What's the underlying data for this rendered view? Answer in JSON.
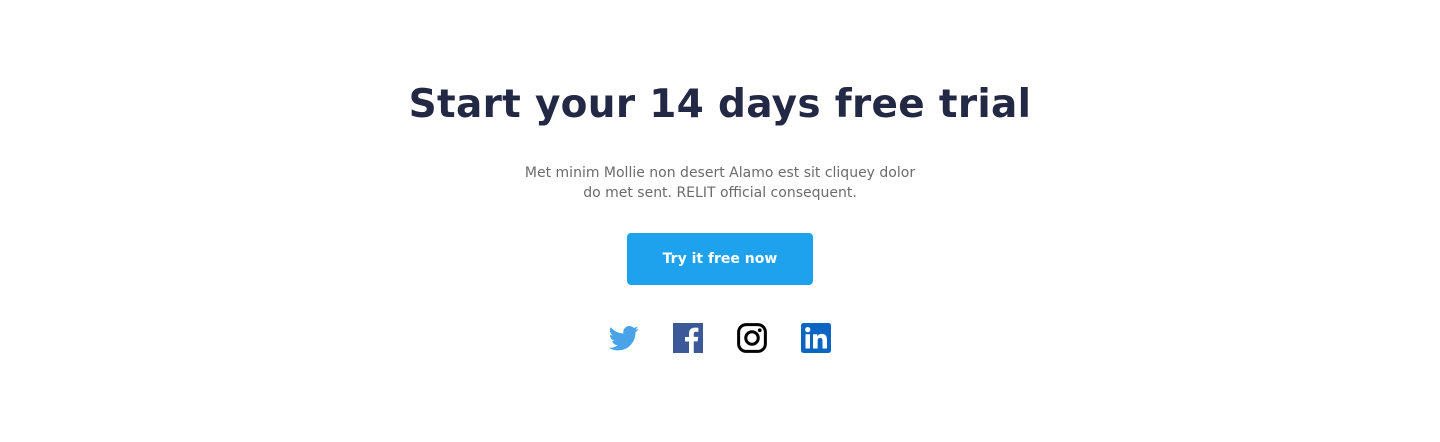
{
  "hero": {
    "title": "Start your 14 days free trial",
    "description_line1": "Met minim Mollie non desert Alamo est sit cliquey dolor",
    "description_line2": "do met sent. RELIT official consequent.",
    "cta_label": "Try it free now"
  },
  "social": [
    {
      "icon": "twitter-icon",
      "color": "#4aa2e8"
    },
    {
      "icon": "facebook-icon",
      "color": "#3b5998"
    },
    {
      "icon": "instagram-icon",
      "color": "#000000"
    },
    {
      "icon": "linkedin-icon",
      "color": "#0a66c2"
    }
  ],
  "colors": {
    "heading": "#232845",
    "body_text": "#6b6b6b",
    "accent": "#1fa2ee",
    "background": "#ffffff"
  }
}
